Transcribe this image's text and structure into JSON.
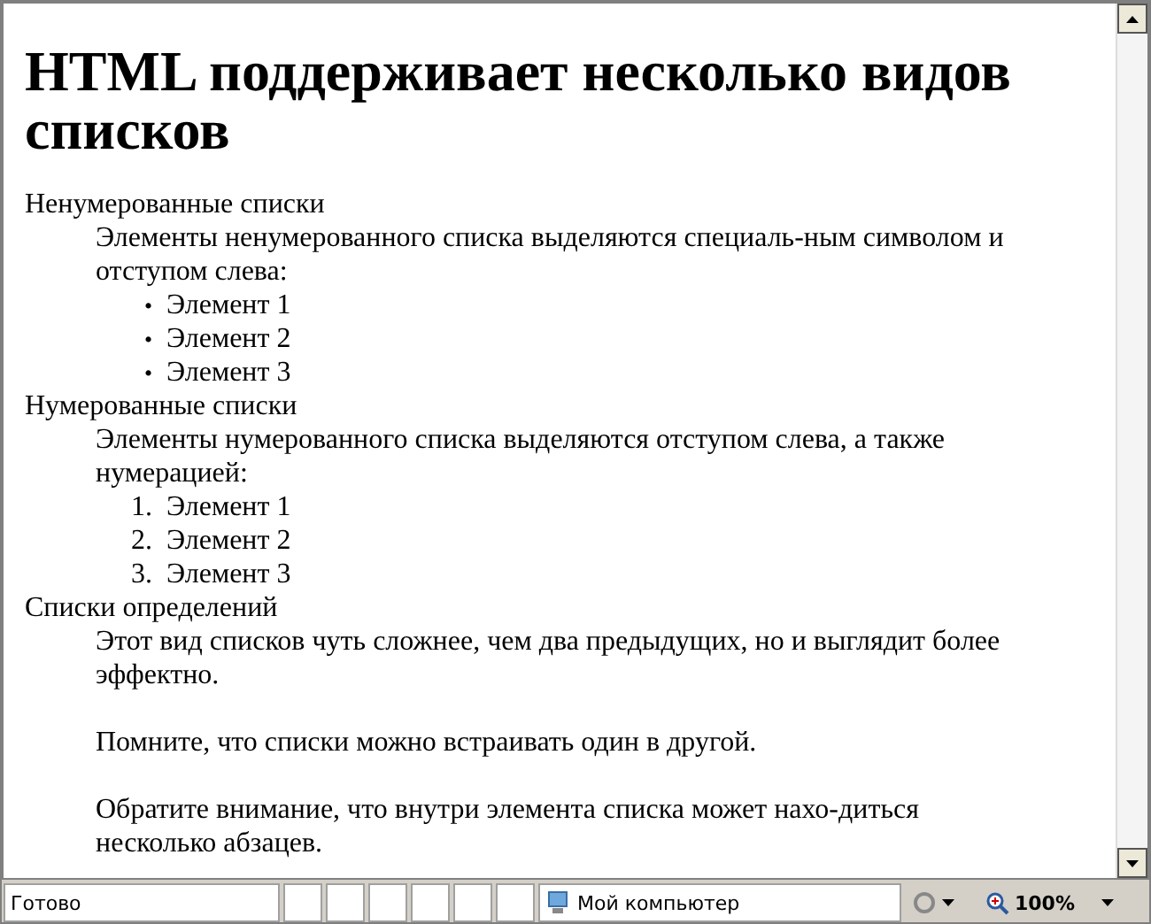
{
  "page": {
    "heading": "HTML поддерживает несколько видов списков",
    "sections": [
      {
        "term": "Ненумерованные списки",
        "paragraphs": [
          "Элементы ненумерованного списка выделяются специаль-ным символом и отступом слева:"
        ],
        "list": {
          "kind": "bullet",
          "items": [
            {
              "marker": "•",
              "text": "Элемент 1"
            },
            {
              "marker": "•",
              "text": "Элемент 2"
            },
            {
              "marker": "•",
              "text": "Элемент 3"
            }
          ]
        }
      },
      {
        "term": "Нумерованные списки",
        "paragraphs": [
          "Элементы нумерованного списка выделяются отступом слева, а также нумерацией:"
        ],
        "list": {
          "kind": "numbered",
          "items": [
            {
              "marker": "1.",
              "text": "Элемент 1"
            },
            {
              "marker": "2.",
              "text": "Элемент 2"
            },
            {
              "marker": "3.",
              "text": "Элемент 3"
            }
          ]
        }
      },
      {
        "term": "Списки определений",
        "paragraphs": [
          "Этот вид списков чуть сложнее, чем два предыдущих, но и выглядит более эффектно.",
          "Помните, что списки можно встраивать один в другой.",
          "Обратите внимание, что внутри элемента списка может нахо-диться несколько абзацев."
        ]
      }
    ]
  },
  "status_bar": {
    "status": "Готово",
    "zone": "Мой компьютер",
    "zoom": "100%"
  }
}
